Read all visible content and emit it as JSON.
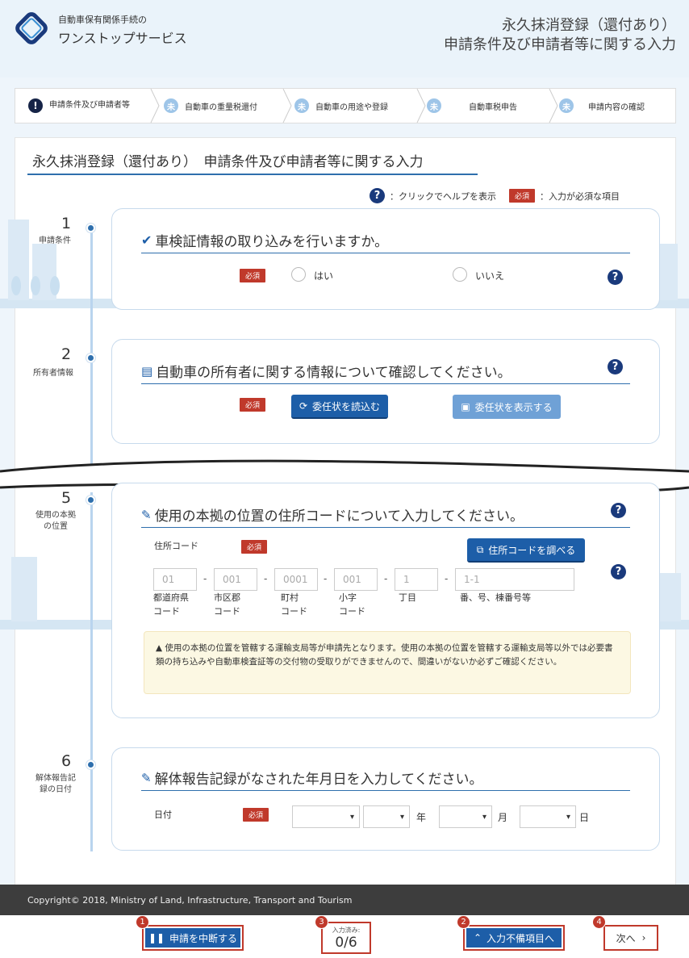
{
  "header": {
    "brand_line1": "自動車保有関係手続の",
    "brand_line2": "ワンストップサービス",
    "title_line1": "永久抹消登録（還付あり）",
    "title_line2": "申請条件及び申請者等に関する入力"
  },
  "steps": [
    {
      "label": "申請条件及び申請者等",
      "icon": "!"
    },
    {
      "label": "自動車の重量税還付",
      "icon": "未"
    },
    {
      "label": "自動車の用途や登録",
      "icon": "未"
    },
    {
      "label": "自動車税申告",
      "icon": "未"
    },
    {
      "label": "申請内容の確認",
      "icon": "未"
    }
  ],
  "page": {
    "title": "永久抹消登録（還付あり）　申請条件及び申請者等に関する入力"
  },
  "legend": {
    "help_icon": "?",
    "help_text": "：クリックでヘルプを表示",
    "required_badge": "必須",
    "required_text": "：入力が必須な項目"
  },
  "required": "必須",
  "help": "?",
  "sec1": {
    "num": "1",
    "label": "申請条件",
    "question": "車検証情報の取り込みを行いますか。",
    "yes": "はい",
    "no": "いいえ"
  },
  "sec2": {
    "num": "2",
    "label": "所有者情報",
    "question": "自動車の所有者に関する情報について確認してください。",
    "load_btn": "委任状を読込む",
    "show_btn": "委任状を表示する"
  },
  "sec5": {
    "num": "5",
    "label": "使用の本拠の位置",
    "question": "使用の本拠の位置の住所コードについて入力してください。",
    "field_label": "住所コード",
    "lookup_btn": "住所コードを調べる",
    "inputs": [
      {
        "placeholder": "01",
        "caption": "都道府県\nコード"
      },
      {
        "placeholder": "001",
        "caption": "市区郡\nコード"
      },
      {
        "placeholder": "0001",
        "caption": "町村\nコード"
      },
      {
        "placeholder": "001",
        "caption": "小字\nコード"
      },
      {
        "placeholder": "1",
        "caption": "丁目"
      },
      {
        "placeholder": "1-1",
        "caption": "番、号、棟番号等"
      }
    ],
    "notice": "使用の本拠の位置を管轄する運輸支局等が申請先となります。使用の本拠の位置を管轄する運輸支局等以外では必要書類の持ち込みや自動車検査証等の交付物の受取りができませんので、間違いがないか必ずご確認ください。"
  },
  "sec6": {
    "num": "6",
    "label": "解体報告記録の日付",
    "question": "解体報告記録がなされた年月日を入力してください。",
    "field_label": "日付",
    "year": "年",
    "month": "月",
    "day": "日"
  },
  "footer": {
    "copyright": "Copyright© 2018, Ministry of Land, Infrastructure, Transport and Tourism"
  },
  "bottom": {
    "pause_btn": "申請を中断する",
    "progress_label": "入力済み:",
    "progress_value": "0/6",
    "missing_btn": "入力不備項目へ",
    "next_btn": "次へ",
    "badges": [
      "1",
      "2",
      "3",
      "4"
    ]
  },
  "colors": {
    "primary": "#1d5ea8",
    "required": "#c0392b",
    "footer": "#3d3d3d",
    "highlight": "#c0392b"
  }
}
